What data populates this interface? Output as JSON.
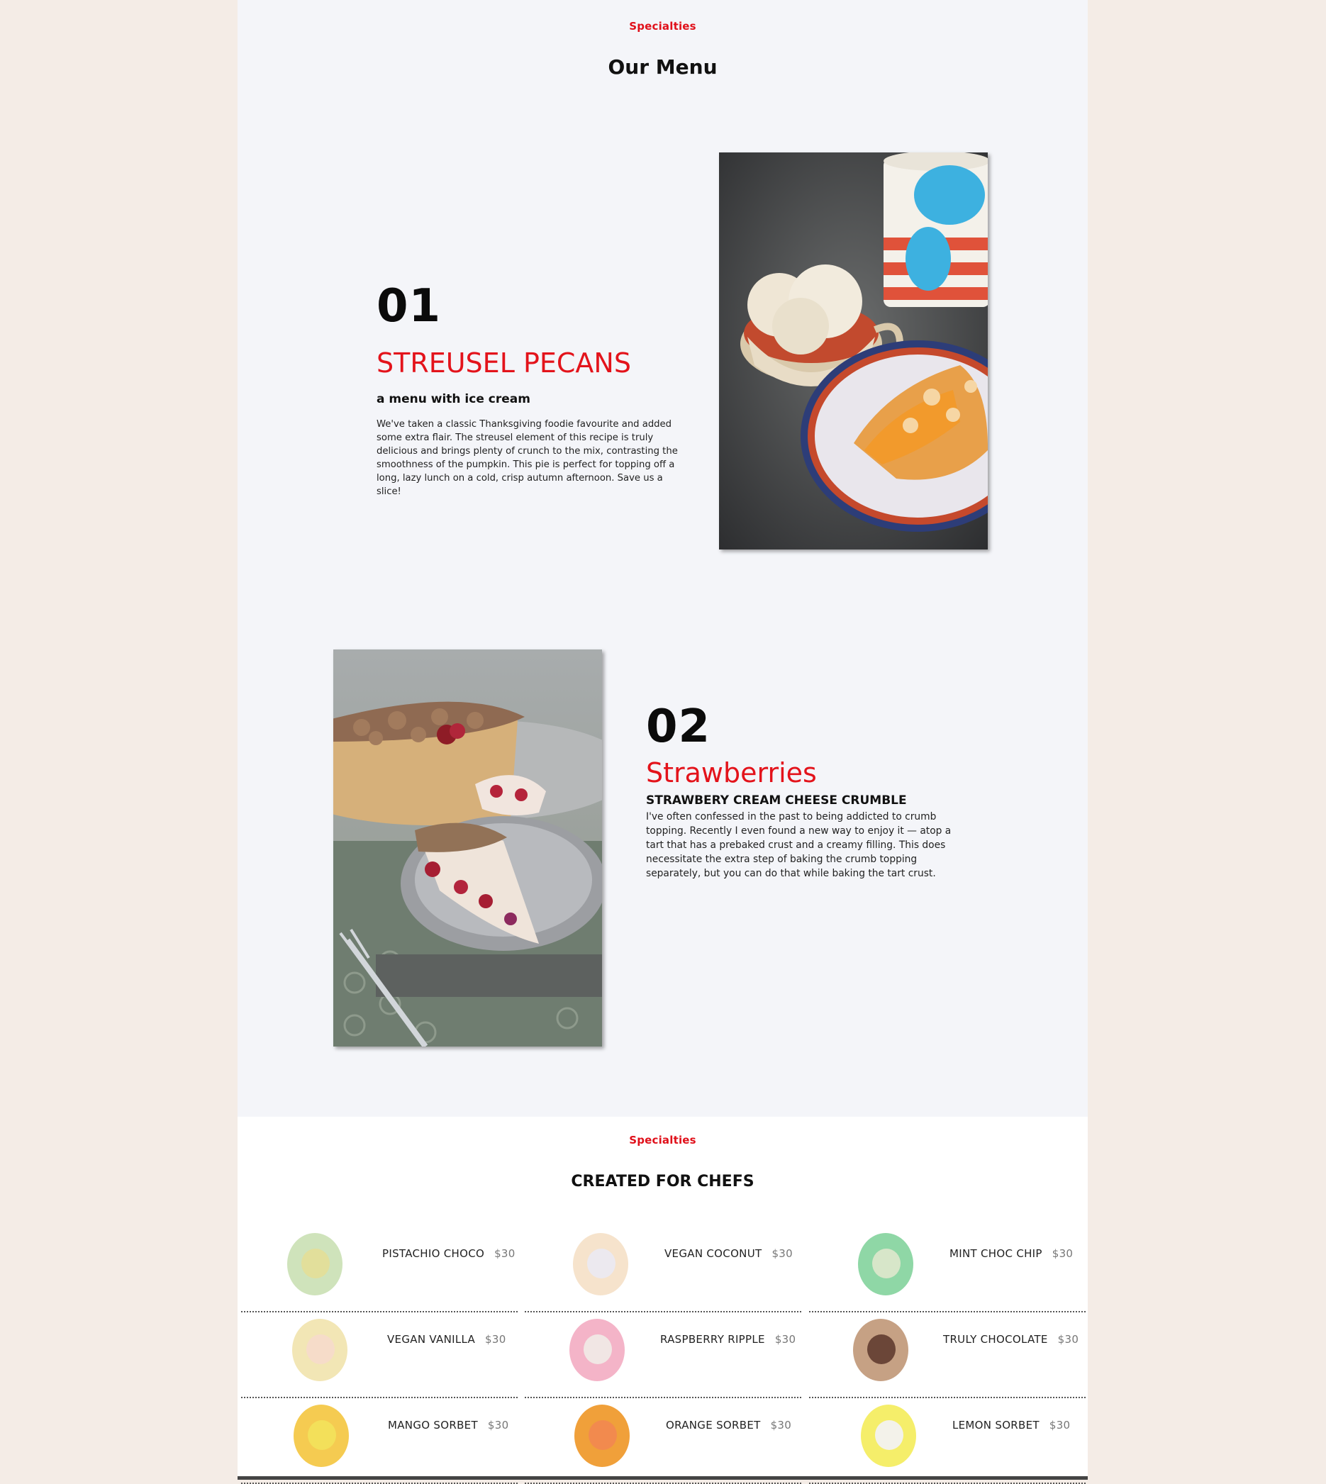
{
  "menu_section": {
    "kicker": "Specialties",
    "title": "Our Menu"
  },
  "items": [
    {
      "number": "01",
      "name": "STREUSEL PECANS",
      "subtitle": "a menu with ice cream",
      "description": "We've taken a classic Thanksgiving foodie favourite and added some extra flair. The streusel element of this recipe is truly delicious and brings plenty of crunch to the mix, contrasting the smoothness of the pumpkin. This pie is perfect for topping off a long, lazy lunch on a cold, crisp autumn afternoon. Save us a slice!"
    },
    {
      "number": "02",
      "name": "Strawberries",
      "subtitle": "STRAWBERY CREAM CHEESE CRUMBLE",
      "description": "I've often confessed in the past to being addicted to crumb topping. Recently I even found a new way to enjoy it — atop a tart that has a prebaked crust and a creamy filling. This does necessitate the extra step of baking the crumb topping separately, but you can do that while baking the tart crust."
    }
  ],
  "chefs_section": {
    "kicker": "Specialties",
    "title": "CREATED FOR CHEFS"
  },
  "flavors": [
    {
      "name": "PISTACHIO CHOCO",
      "price": "$30",
      "plate": "#cfe3bb",
      "scoop": "#e2df9b"
    },
    {
      "name": "VEGAN COCONUT",
      "price": "$30",
      "plate": "#f6e3cc",
      "scoop": "#ece9ef"
    },
    {
      "name": "MINT CHOC CHIP",
      "price": "$30",
      "plate": "#8fd7a6",
      "scoop": "#d7e6c9"
    },
    {
      "name": "VEGAN VANILLA",
      "price": "$30",
      "plate": "#f2e6b5",
      "scoop": "#f6dcc9"
    },
    {
      "name": "RASPBERRY RIPPLE",
      "price": "$30",
      "plate": "#f4b4c8",
      "scoop": "#f1e6e4"
    },
    {
      "name": "TRULY CHOCOLATE",
      "price": "$30",
      "plate": "#c6a184",
      "scoop": "#6b4638"
    },
    {
      "name": "MANGO SORBET",
      "price": "$30",
      "plate": "#f5cb51",
      "scoop": "#f3e05a"
    },
    {
      "name": "ORANGE SORBET",
      "price": "$30",
      "plate": "#f0a03a",
      "scoop": "#f28a4e"
    },
    {
      "name": "LEMON SORBET",
      "price": "$30",
      "plate": "#f5ee6a",
      "scoop": "#f3f2ea"
    }
  ]
}
